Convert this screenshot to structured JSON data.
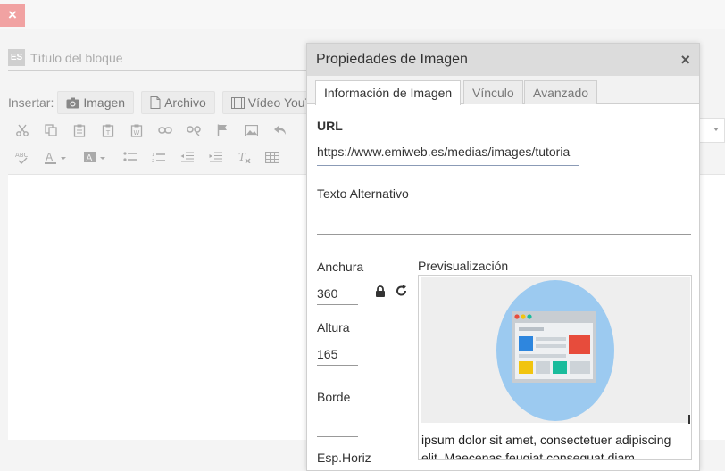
{
  "editor": {
    "lang_badge": "ES",
    "title_placeholder": "Título del bloque",
    "insert_label": "Insertar:",
    "insert_buttons": [
      "Imagen",
      "Archivo",
      "Vídeo YouTu"
    ]
  },
  "dialog": {
    "title": "Propiedades de Imagen",
    "close_glyph": "×",
    "tabs": [
      "Información de Imagen",
      "Vínculo",
      "Avanzado"
    ],
    "url_label": "URL",
    "url_value": "https://www.emiweb.es/medias/images/tutoria",
    "alt_label": "Texto Alternativo",
    "alt_value": "",
    "width_label": "Anchura",
    "width_value": "360",
    "height_label": "Altura",
    "height_value": "165",
    "border_label": "Borde",
    "border_value": "",
    "hspace_label": "Esp.Horiz",
    "preview_label": "Previsualización",
    "preview_text": "ipsum dolor sit amet, consectetuer adipiscing elit. Maecenas feugiat consequat diam."
  },
  "top_close_glyph": "×",
  "colors": {
    "dialog_header": "#dcdcdc",
    "close_pink": "#f1a2a2",
    "illus_circle": "#9ccaf0",
    "illus_blue": "#2e86de",
    "illus_red": "#e74c3c",
    "illus_yellow": "#f1c40f",
    "illus_teal": "#1abc9c"
  }
}
